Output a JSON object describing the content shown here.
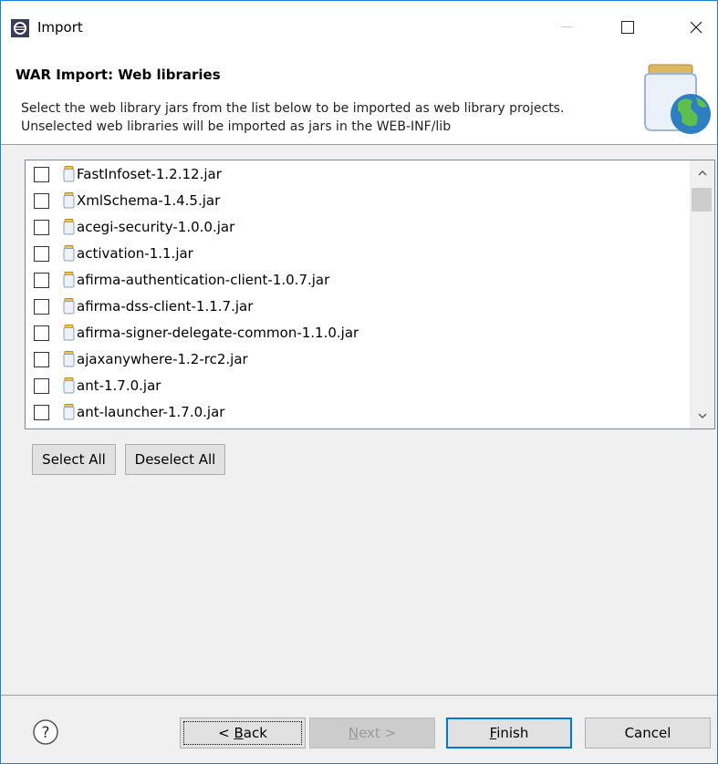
{
  "window": {
    "title": "Import",
    "icon": "eclipse-icon",
    "minimize_icon": "minimize-icon",
    "maximize_icon": "maximize-icon",
    "close_icon": "close-icon"
  },
  "header": {
    "title": "WAR Import: Web libraries",
    "description": "Select the web library jars from the list below to be imported as web library projects.  Unselected web libraries will be imported as jars in the WEB-INF/lib",
    "banner_icon": "web-library-banner-icon"
  },
  "libraries": [
    {
      "name": "FastInfoset-1.2.12.jar",
      "checked": false
    },
    {
      "name": "XmlSchema-1.4.5.jar",
      "checked": false
    },
    {
      "name": "acegi-security-1.0.0.jar",
      "checked": false
    },
    {
      "name": "activation-1.1.jar",
      "checked": false
    },
    {
      "name": "afirma-authentication-client-1.0.7.jar",
      "checked": false
    },
    {
      "name": "afirma-dss-client-1.1.7.jar",
      "checked": false
    },
    {
      "name": "afirma-signer-delegate-common-1.1.0.jar",
      "checked": false
    },
    {
      "name": "ajaxanywhere-1.2-rc2.jar",
      "checked": false
    },
    {
      "name": "ant-1.7.0.jar",
      "checked": false
    },
    {
      "name": "ant-launcher-1.7.0.jar",
      "checked": false
    }
  ],
  "list_buttons": {
    "select_all": "Select All",
    "deselect_all": "Deselect All"
  },
  "footer": {
    "help_icon": "help-icon",
    "back": {
      "prefix": "< ",
      "mnemonic": "B",
      "rest": "ack"
    },
    "next": {
      "mnemonic": "N",
      "rest": "ext >",
      "enabled": false
    },
    "finish": {
      "mnemonic": "F",
      "rest": "inish"
    },
    "cancel": "Cancel"
  }
}
